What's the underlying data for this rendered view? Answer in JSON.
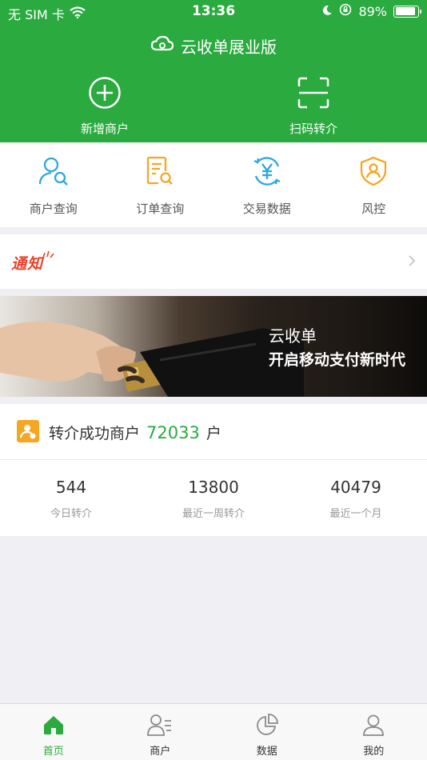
{
  "status_bar": {
    "carrier": "无 SIM 卡",
    "time": "13:36",
    "battery": "89%",
    "battery_level": 0.89
  },
  "header": {
    "title": "云收单展业版",
    "actions": [
      {
        "label": "新增商户",
        "icon": "add-circle-icon"
      },
      {
        "label": "扫码转介",
        "icon": "scan-icon"
      }
    ]
  },
  "menu": [
    {
      "label": "商户查询",
      "icon": "merchant-search-icon",
      "color": "#2ea7e0"
    },
    {
      "label": "订单查询",
      "icon": "order-search-icon",
      "color": "#f5a623"
    },
    {
      "label": "交易数据",
      "icon": "transaction-icon",
      "color": "#2ea7e0"
    },
    {
      "label": "风控",
      "icon": "risk-shield-icon",
      "color": "#f5a623"
    }
  ],
  "notice": {
    "badge": "通知"
  },
  "banner": {
    "title": "云收单",
    "subtitle": "开启移动支付新时代"
  },
  "stats": {
    "label": "转介成功商户",
    "count": "72033",
    "unit": "户",
    "items": [
      {
        "value": "544",
        "caption": "今日转介"
      },
      {
        "value": "13800",
        "caption": "最近一周转介"
      },
      {
        "value": "40479",
        "caption": "最近一个月"
      }
    ]
  },
  "tabs": [
    {
      "label": "首页",
      "icon": "home-icon",
      "active": true
    },
    {
      "label": "商户",
      "icon": "merchant-icon",
      "active": false
    },
    {
      "label": "数据",
      "icon": "data-pie-icon",
      "active": false
    },
    {
      "label": "我的",
      "icon": "profile-icon",
      "active": false
    }
  ],
  "colors": {
    "brand": "#2aaa3f",
    "accent_blue": "#2ea7e0",
    "accent_orange": "#f5a623",
    "notice_red": "#e8422c"
  }
}
